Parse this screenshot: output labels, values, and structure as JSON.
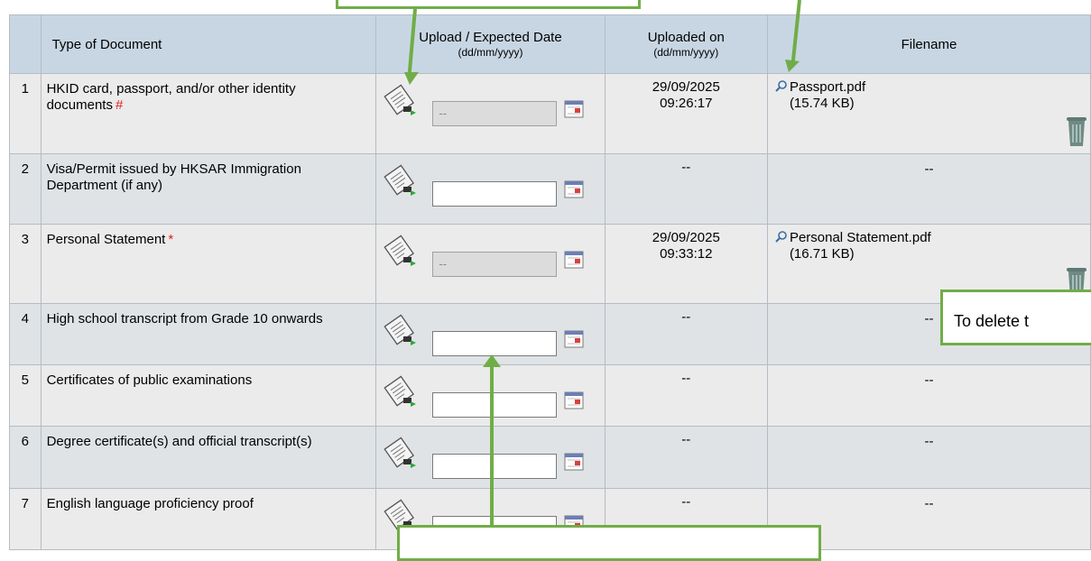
{
  "table": {
    "headers": {
      "num": "",
      "type": "Type of Document",
      "upload": "Upload / Expected Date",
      "upload_sub": "(dd/mm/yyyy)",
      "uploaded": "Uploaded on",
      "uploaded_sub": "(dd/mm/yyyy)",
      "filename": "Filename"
    },
    "rows": [
      {
        "num": "1",
        "type": "HKID card, passport, and/or other identity documents",
        "mark": "#",
        "date_value": "--",
        "uploaded_date": "29/09/2025",
        "uploaded_time": "09:26:17",
        "file_name": "Passport.pdf",
        "file_size": "(15.74 KB)"
      },
      {
        "num": "2",
        "type": "Visa/Permit issued by HKSAR Immigration Department (if any)",
        "mark": "",
        "date_value": "",
        "uploaded_date": "--",
        "uploaded_time": "",
        "file_name": "--",
        "file_size": ""
      },
      {
        "num": "3",
        "type": "Personal Statement",
        "mark": "*",
        "date_value": "--",
        "uploaded_date": "29/09/2025",
        "uploaded_time": "09:33:12",
        "file_name": "Personal Statement.pdf",
        "file_size": "(16.71 KB)"
      },
      {
        "num": "4",
        "type": "High school transcript from Grade 10 onwards",
        "mark": "",
        "date_value": "",
        "uploaded_date": "--",
        "uploaded_time": "",
        "file_name": "--",
        "file_size": ""
      },
      {
        "num": "5",
        "type": "Certificates of public examinations",
        "mark": "",
        "date_value": "",
        "uploaded_date": "--",
        "uploaded_time": "",
        "file_name": "--",
        "file_size": ""
      },
      {
        "num": "6",
        "type": "Degree certificate(s) and official transcript(s)",
        "mark": "",
        "date_value": "",
        "uploaded_date": "--",
        "uploaded_time": "",
        "file_name": "--",
        "file_size": ""
      },
      {
        "num": "7",
        "type": "English language proficiency proof",
        "mark": "",
        "date_value": "",
        "uploaded_date": "--",
        "uploaded_time": "",
        "file_name": "--",
        "file_size": ""
      }
    ]
  },
  "callouts": {
    "delete_text": "To delete t"
  },
  "icons": {
    "upload": "upload-scroll-icon",
    "calendar": "calendar-icon",
    "view": "magnifier-icon",
    "delete": "trash-bin-icon"
  },
  "colors": {
    "header_bg": "#c8d6e3",
    "row_bg": "#ebebeb",
    "row_alt_bg": "#dfe3e6",
    "required_mark": "#e02020",
    "callout_border": "#70ad47"
  }
}
